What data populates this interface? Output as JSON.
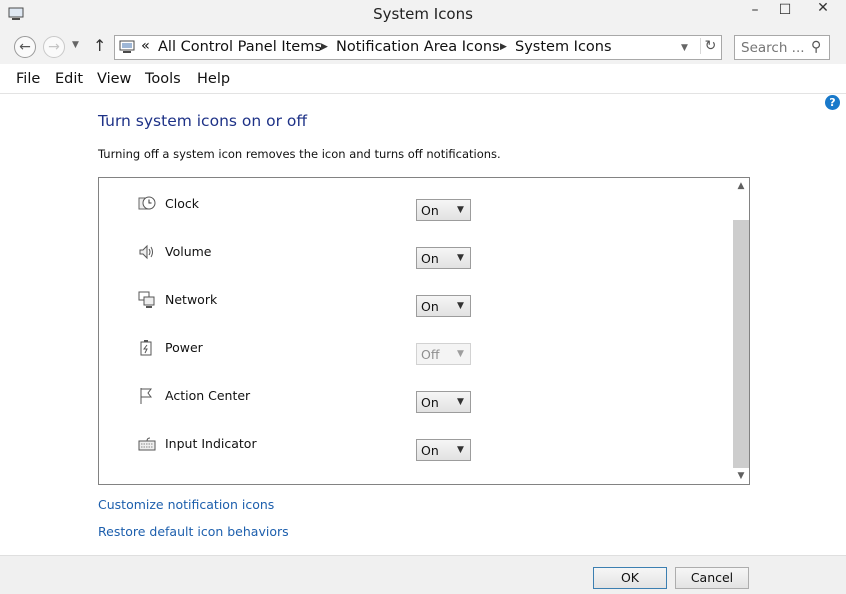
{
  "window": {
    "title": "System Icons",
    "controls": {
      "minimize": "–",
      "maximize": "☐",
      "close": "✕"
    }
  },
  "navigation": {
    "breadcrumb_overflow": "«",
    "breadcrumb": [
      "All Control Panel Items",
      "Notification Area Icons",
      "System Icons"
    ],
    "search_placeholder": "Search ..."
  },
  "menu": [
    "File",
    "Edit",
    "View",
    "Tools",
    "Help"
  ],
  "content": {
    "heading": "Turn system icons on or off",
    "description": "Turning off a system icon removes the icon and turns off notifications.",
    "icons": [
      {
        "label": "Clock",
        "icon": "clock-icon",
        "value": "On",
        "disabled": false
      },
      {
        "label": "Volume",
        "icon": "volume-icon",
        "value": "On",
        "disabled": false
      },
      {
        "label": "Network",
        "icon": "network-icon",
        "value": "On",
        "disabled": false
      },
      {
        "label": "Power",
        "icon": "power-icon",
        "value": "Off",
        "disabled": true
      },
      {
        "label": "Action Center",
        "icon": "flag-icon",
        "value": "On",
        "disabled": false
      },
      {
        "label": "Input Indicator",
        "icon": "keyboard-icon",
        "value": "On",
        "disabled": false
      }
    ],
    "links": {
      "customize": "Customize notification icons",
      "restore": "Restore default icon behaviors"
    }
  },
  "footer": {
    "ok": "OK",
    "cancel": "Cancel"
  },
  "colors": {
    "heading": "#1e3287",
    "link": "#1d5fad",
    "help": "#1979ca"
  }
}
